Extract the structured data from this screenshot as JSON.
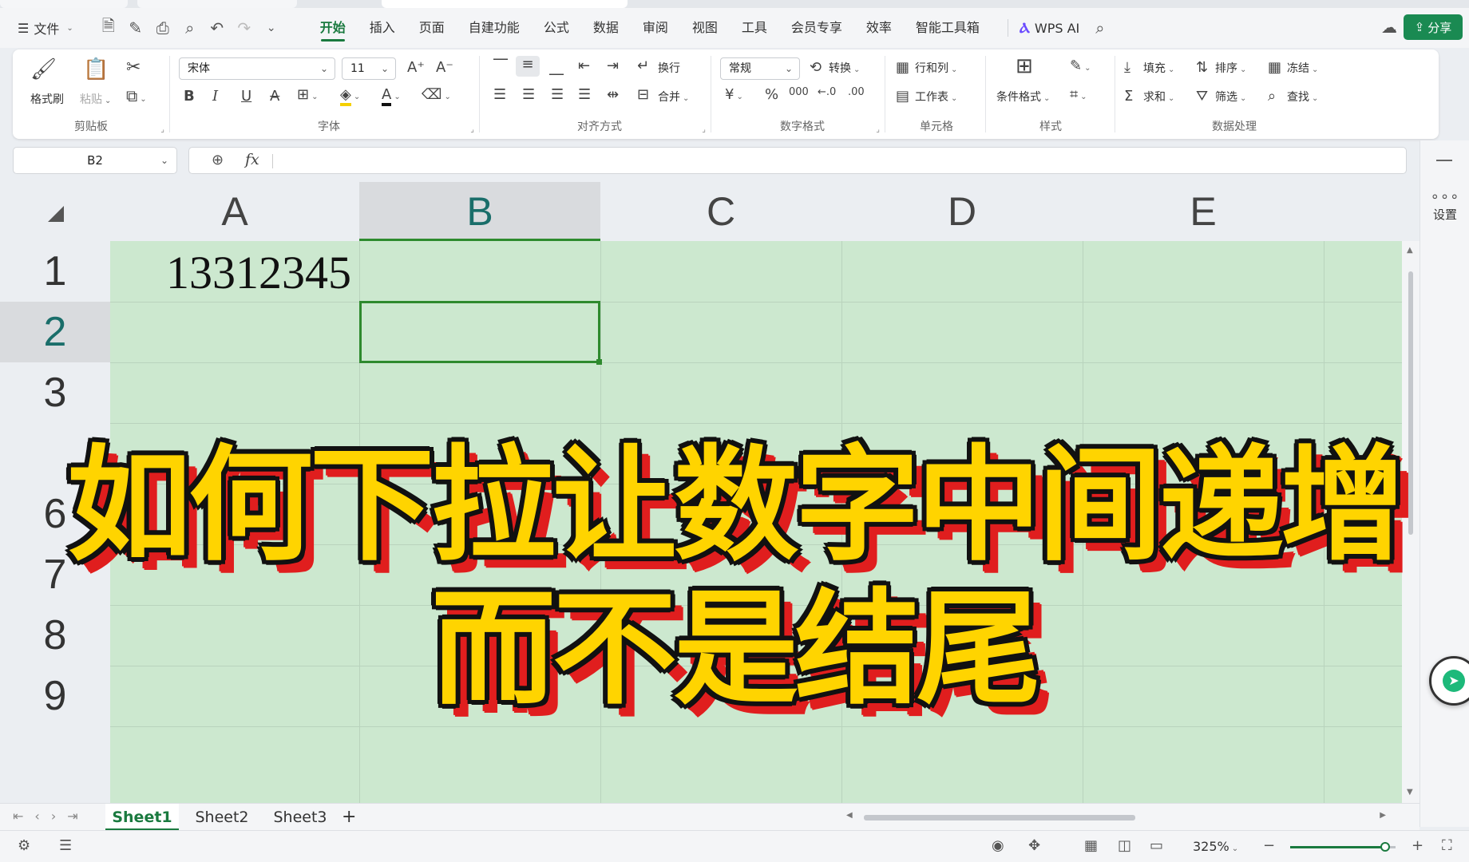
{
  "menubar": {
    "file_label": "文件",
    "tabs": [
      "开始",
      "插入",
      "页面",
      "自建功能",
      "公式",
      "数据",
      "审阅",
      "视图",
      "工具",
      "会员专享",
      "效率",
      "智能工具箱"
    ],
    "active_tab": "开始",
    "wps_ai_label": "WPS AI",
    "share_label": "分享"
  },
  "ribbon": {
    "clipboard": {
      "format_painter": "格式刷",
      "paste": "粘贴",
      "group": "剪贴板"
    },
    "font": {
      "name": "宋体",
      "size": "11",
      "group": "字体"
    },
    "align": {
      "wrap": "换行",
      "merge": "合并",
      "group": "对齐方式"
    },
    "number": {
      "format": "常规",
      "convert": "转换",
      "group": "数字格式"
    },
    "cells": {
      "rowcol": "行和列",
      "sheet": "工作表",
      "group": "单元格"
    },
    "styles": {
      "cond_format": "条件格式",
      "group": "样式"
    },
    "data": {
      "fill": "填充",
      "sort": "排序",
      "freeze": "冻结",
      "sum": "求和",
      "filter": "筛选",
      "find": "查找",
      "group": "数据处理"
    }
  },
  "formula_bar": {
    "name_box": "B2",
    "fx_label": "fx",
    "value": ""
  },
  "sidepanel": {
    "settings_label": "设置"
  },
  "grid": {
    "columns": [
      "A",
      "B",
      "C",
      "D",
      "E"
    ],
    "rows": [
      "1",
      "2",
      "3",
      "6",
      "7",
      "8",
      "9"
    ],
    "selected_column": "B",
    "selected_row": "2",
    "cell_A1": "13312345"
  },
  "caption": {
    "line1": "如何下拉让数字中间递增",
    "line2": "而不是结尾"
  },
  "sheets": {
    "tabs": [
      "Sheet1",
      "Sheet2",
      "Sheet3"
    ],
    "active": "Sheet1"
  },
  "status": {
    "zoom": "325%",
    "zoom_level_percent": 90
  },
  "colors": {
    "accent": "#1a7a3f",
    "cell_bg": "#cce8cf",
    "caption_fill": "#ffd400",
    "caption_shadow": "#e01e1e"
  }
}
